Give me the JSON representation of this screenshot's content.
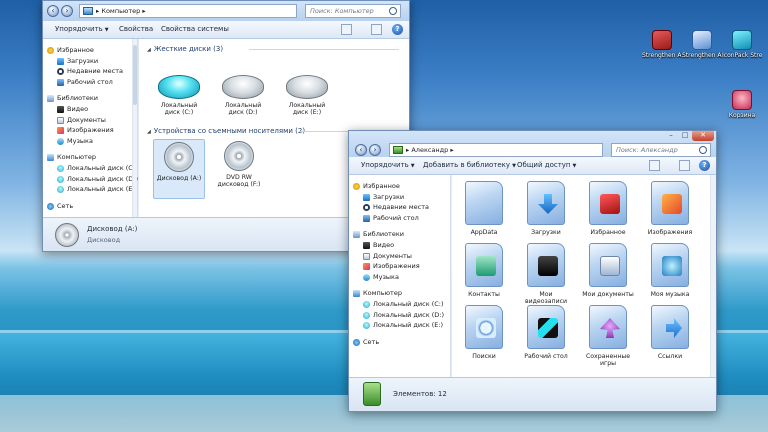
{
  "desktop": {
    "icons": [
      {
        "label": "Strengthen AERO SX...",
        "icon": "strengthen-red-icon",
        "color": "#c42a2a"
      },
      {
        "label": "Strengthen AERO SX...",
        "icon": "strengthen-blue-icon",
        "color": "#5b8fd2"
      },
      {
        "label": "IconPack Strength...",
        "icon": "iconpack-icon",
        "color": "#0f8fb5"
      },
      {
        "label": "Корзина",
        "icon": "recycle-bin-icon",
        "color": "#c42a52"
      }
    ]
  },
  "computer_window": {
    "address": "Компьютер",
    "search_placeholder": "Поиск: Компьютер",
    "toolbar": {
      "organize": "Упорядочить",
      "properties": "Свойства",
      "system_properties": "Свойства системы"
    },
    "sidebar": {
      "favorites": "Избранное",
      "downloads": "Загрузки",
      "recent": "Недавние места",
      "desktop": "Рабочий стол",
      "libraries": "Библиотеки",
      "video": "Видео",
      "documents": "Документы",
      "images": "Изображения",
      "music": "Музыка",
      "computer": "Компьютер",
      "disk_c": "Локальный диск (C:)",
      "disk_d": "Локальный диск (D:)",
      "disk_e": "Локальный диск (E:)",
      "network": "Сеть"
    },
    "groups": {
      "hard_drives": "Жесткие диски (3)",
      "removable": "Устройства со съемными носителями (2)"
    },
    "drives": [
      {
        "label": "Локальный диск (C:)"
      },
      {
        "label": "Локальный диск (D:)"
      },
      {
        "label": "Локальный диск (E:)"
      }
    ],
    "removable": [
      {
        "label": "Дисковод (A:)"
      },
      {
        "label": "DVD RW дисковод (F:)"
      }
    ],
    "details": {
      "name": "Дисковод (A:)",
      "type": "Дисковод"
    }
  },
  "user_window": {
    "address": "Александр",
    "search_placeholder": "Поиск: Александр",
    "toolbar": {
      "organize": "Упорядочить",
      "add_library": "Добавить в библиотеку",
      "share": "Общий доступ"
    },
    "sidebar": {
      "favorites": "Избранное",
      "downloads": "Загрузки",
      "recent": "Недавние места",
      "desktop": "Рабочий стол",
      "libraries": "Библиотеки",
      "video": "Видео",
      "documents": "Документы",
      "images": "Изображения",
      "music": "Музыка",
      "computer": "Компьютер",
      "disk_c": "Локальный диск (C:)",
      "disk_d": "Локальный диск (D:)",
      "disk_e": "Локальный диск (E:)",
      "network": "Сеть"
    },
    "folders": [
      {
        "label": "AppData",
        "icon": "none"
      },
      {
        "label": "Загрузки",
        "icon": "arrow"
      },
      {
        "label": "Избранное",
        "icon": "fav"
      },
      {
        "label": "Изображения",
        "icon": "img"
      },
      {
        "label": "Контакты",
        "icon": "contact"
      },
      {
        "label": "Мои видеозаписи",
        "icon": "video"
      },
      {
        "label": "Мои документы",
        "icon": "doc"
      },
      {
        "label": "Моя музыка",
        "icon": "music"
      },
      {
        "label": "Поиски",
        "icon": "search"
      },
      {
        "label": "Рабочий стол",
        "icon": "desk"
      },
      {
        "label": "Сохраненные игры",
        "icon": "games"
      },
      {
        "label": "Ссылки",
        "icon": "links"
      }
    ],
    "status": "Элементов: 12"
  }
}
